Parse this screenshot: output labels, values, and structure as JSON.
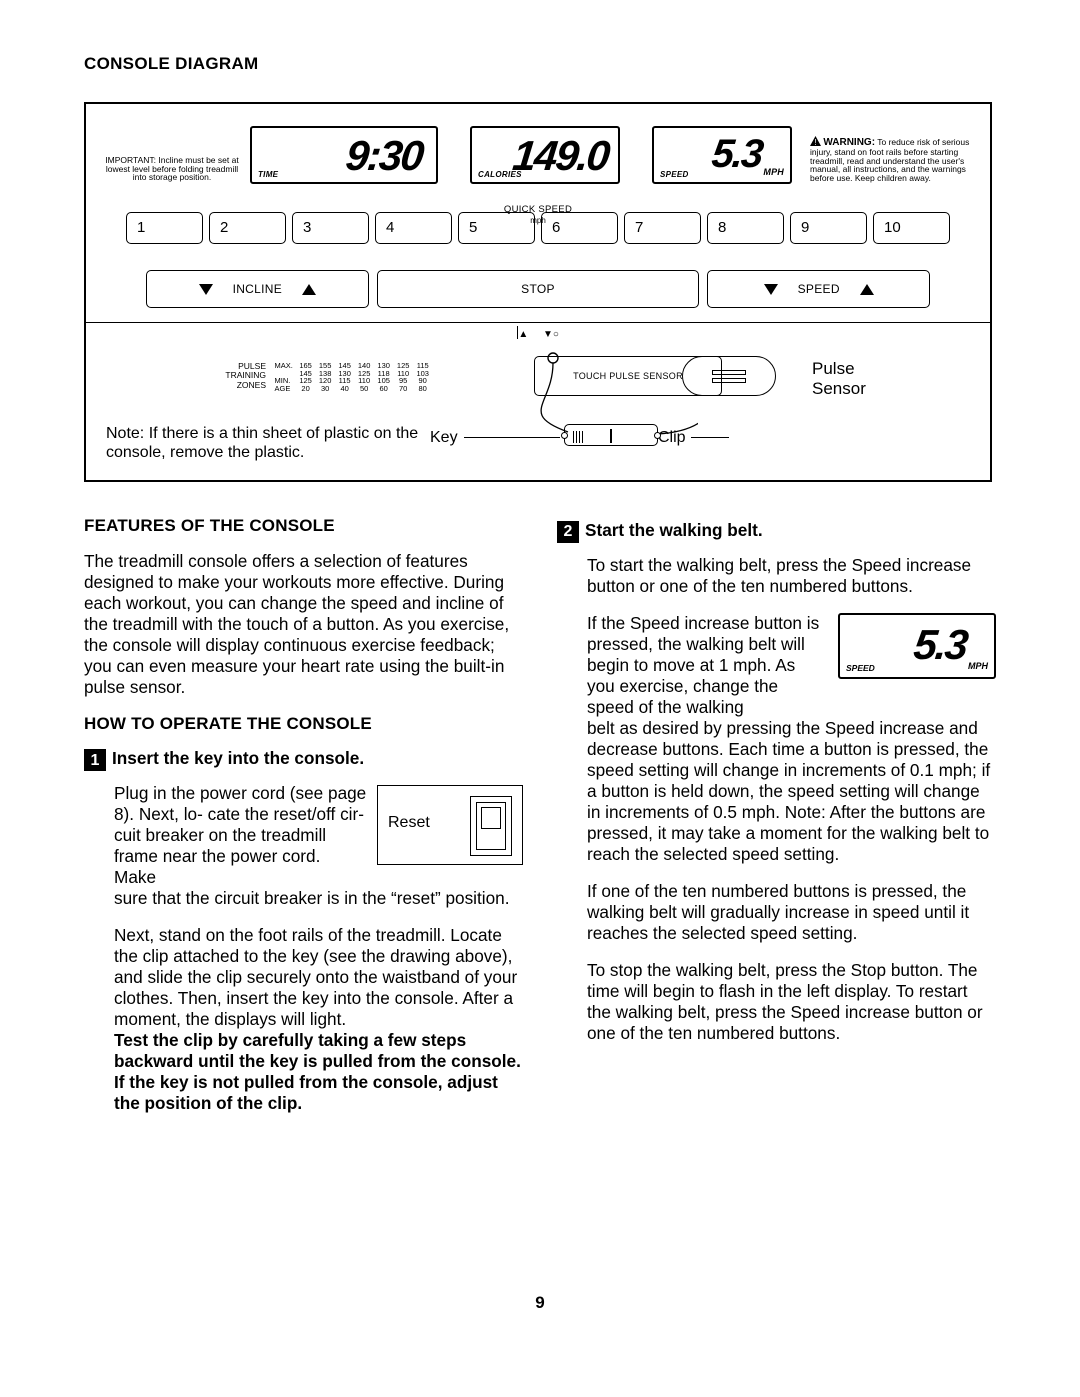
{
  "title": "CONSOLE DIAGRAM",
  "page_number": "9",
  "console": {
    "important": "IMPORTANT: Incline must be set at lowest level before folding treadmill into storage position.",
    "warning_head": "WARNING:",
    "warning_body": "To reduce risk of serious injury, stand on foot rails before starting treadmill, read and understand the user's manual, all instructions, and the warnings before use. Keep children away.",
    "lcd": {
      "time_label": "TIME",
      "time_value": "9:30",
      "cal_label": "CALORIES",
      "cal_value": "149.0",
      "speed_label": "SPEED",
      "speed_unit": "MPH",
      "speed_value": "5.3"
    },
    "quick_speed_label": "QUICK SPEED",
    "quick_speed_unit": "mph",
    "quick_speed_buttons": [
      "1",
      "2",
      "3",
      "4",
      "5",
      "6",
      "7",
      "8",
      "9",
      "10"
    ],
    "incline_label": "INCLINE",
    "stop_label": "STOP",
    "speed_btn_label": "SPEED",
    "ptz_label": "PULSE\nTRAINING\nZONES",
    "ptz_rows": [
      {
        "h": "MAX.",
        "v": [
          "165",
          "155",
          "145",
          "140",
          "130",
          "125",
          "115"
        ]
      },
      {
        "h": "",
        "v": [
          "145",
          "138",
          "130",
          "125",
          "118",
          "110",
          "103"
        ]
      },
      {
        "h": "MIN.",
        "v": [
          "125",
          "120",
          "115",
          "110",
          "105",
          "95",
          "90"
        ]
      },
      {
        "h": "AGE",
        "v": [
          "20",
          "30",
          "40",
          "50",
          "60",
          "70",
          "80"
        ]
      }
    ],
    "touch_sensor": "TOUCH PULSE SENSOR",
    "pulse_sensor_label": "Pulse\nSensor",
    "plastic_note": "Note: If there is a thin sheet of plastic on the console, remove the plastic.",
    "key_label": "Key",
    "clip_label": "Clip"
  },
  "body": {
    "features_h": "FEATURES OF THE CONSOLE",
    "features_p": "The treadmill console offers a selection of features designed to make your workouts more effective. During each workout, you can change the speed and incline of the treadmill with the touch of a button. As you exercise, the console will display continuous exercise feedback; you can even measure your heart rate using the built-in pulse sensor.",
    "howto_h": "HOW TO OPERATE THE CONSOLE",
    "step1_num": "1",
    "step1_title": "Insert the key into the console.",
    "step1_reset_label": "Reset",
    "step1_p1a": "Plug in the power cord (see page 8). Next, lo- cate the reset/off cir- cuit breaker on the treadmill frame near the power cord. Make",
    "step1_p1b": "sure that the circuit breaker is in the “reset” position.",
    "step1_p2": "Next, stand on the foot rails of the treadmill. Locate the clip attached to the key (see the drawing above), and slide the clip securely onto the waistband of your clothes. Then, insert the key into the console. After a moment, the displays will light.",
    "step1_bold": "Test the clip by carefully taking a few steps backward until the key is pulled from the console. If the key is not pulled from the console, adjust the position of the clip.",
    "step2_num": "2",
    "step2_title": "Start the walking belt.",
    "step2_p1": "To start the walking belt, press the Speed increase button or one of the ten numbered buttons.",
    "step2_p2a": "If the Speed increase button is pressed, the walking belt will begin to move at 1 mph. As you exercise, change the speed of the walking",
    "step2_p2b": "belt as desired by pressing the Speed increase and decrease buttons. Each time a button is pressed, the speed setting will change in increments of 0.1 mph; if a button is held down, the speed setting will change in increments of 0.5 mph. Note: After the buttons are pressed, it may take a moment for the walking belt to reach the selected speed setting.",
    "step2_p3": "If one of the ten numbered buttons is pressed, the walking belt will gradually increase in speed until it reaches the selected speed setting.",
    "step2_p4": "To stop the walking belt, press the Stop button. The time will begin to flash in the left display. To restart the walking belt, press the Speed increase button or one of the ten numbered buttons.",
    "mini_speed": {
      "label": "SPEED",
      "unit": "MPH",
      "value": "5.3"
    }
  }
}
